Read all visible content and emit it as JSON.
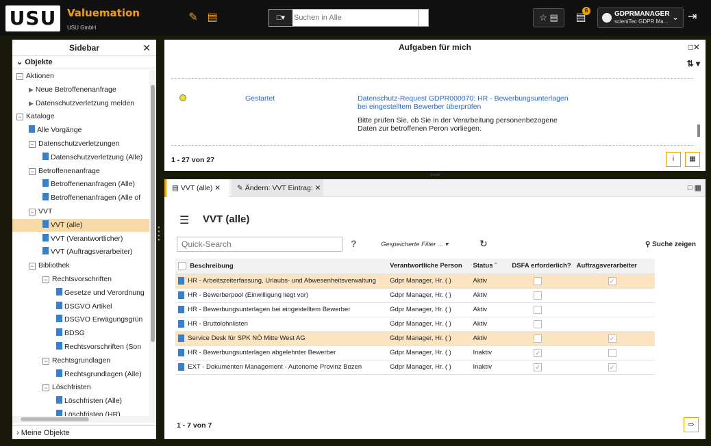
{
  "topbar": {
    "logo": "USU",
    "brand": "Valuemation",
    "brand_sub": "USU GmbH",
    "search_placeholder": "Suchen in Alle",
    "notifications_count": "6",
    "user_name": "GDPRMANAGER",
    "user_org": "scieniTec GDPR Ma..."
  },
  "sidebar": {
    "title": "Sidebar",
    "section": "Objekte",
    "footer": "Meine Objekte",
    "tree": [
      {
        "label": "Aktionen",
        "level": 0,
        "kind": "folder"
      },
      {
        "label": "Neue Betroffenenanfrage",
        "level": 1,
        "kind": "action"
      },
      {
        "label": "Datenschutzverletzung melden",
        "level": 1,
        "kind": "action"
      },
      {
        "label": "Kataloge",
        "level": 0,
        "kind": "folder"
      },
      {
        "label": "Alle Vorgänge",
        "level": 1,
        "kind": "doc"
      },
      {
        "label": "Datenschutzverletzungen",
        "level": 1,
        "kind": "folder"
      },
      {
        "label": "Datenschutzverletzung (Alle)",
        "level": 2,
        "kind": "doc"
      },
      {
        "label": "Betroffenenanfrage",
        "level": 1,
        "kind": "folder"
      },
      {
        "label": "Betroffenenanfragen (Alle)",
        "level": 2,
        "kind": "doc"
      },
      {
        "label": "Betroffenenanfragen (Alle of",
        "level": 2,
        "kind": "doc"
      },
      {
        "label": "VVT",
        "level": 1,
        "kind": "folder"
      },
      {
        "label": "VVT (alle)",
        "level": 2,
        "kind": "doc",
        "selected": true
      },
      {
        "label": "VVT (Verantwortlicher)",
        "level": 2,
        "kind": "doc"
      },
      {
        "label": "VVT (Auftragsverarbeiter)",
        "level": 2,
        "kind": "doc"
      },
      {
        "label": "Bibliothek",
        "level": 1,
        "kind": "folder"
      },
      {
        "label": "Rechtsvorschriften",
        "level": 2,
        "kind": "folder"
      },
      {
        "label": "Gesetze und Verordnung",
        "level": 3,
        "kind": "doc"
      },
      {
        "label": "DSGVO Artikel",
        "level": 3,
        "kind": "doc"
      },
      {
        "label": "DSGVO Erwägungsgrün",
        "level": 3,
        "kind": "doc"
      },
      {
        "label": "BDSG",
        "level": 3,
        "kind": "doc"
      },
      {
        "label": "Rechtsvorschriften (Son",
        "level": 3,
        "kind": "doc"
      },
      {
        "label": "Rechtsgrundlagen",
        "level": 2,
        "kind": "folder"
      },
      {
        "label": "Rechtsgrundlagen (Alle)",
        "level": 3,
        "kind": "doc"
      },
      {
        "label": "Löschfristen",
        "level": 2,
        "kind": "folder"
      },
      {
        "label": "Löschfristen (Alle)",
        "level": 3,
        "kind": "doc"
      },
      {
        "label": "Löschfristen (HR)",
        "level": 3,
        "kind": "doc"
      }
    ]
  },
  "tasks": {
    "title": "Aufgaben für mich",
    "status": "Gestartet",
    "link": "Datenschutz-Request GDPR000070: HR - Bewerbungsunterlagen bei eingestelltem Bewerber überprüfen",
    "description": "Bitte prüfen Sie, ob Sie in der Verarbeitung personenbezogene Daten zur betroffenen Peron vorliegen.",
    "count": "1 - 27 von 27"
  },
  "tabs": [
    {
      "label": "VVT (alle)"
    },
    {
      "label": "Ändern: VVT Eintrag:"
    }
  ],
  "list": {
    "title": "VVT (alle)",
    "quick_search_placeholder": "Quick-Search",
    "saved_filter": "Gespeicherte Filter ...",
    "search_show": "Suche zeigen",
    "columns": [
      "Beschreibung",
      "Verantwortliche Person",
      "Status",
      "DSFA erforderlich?",
      "Auftragsverarbeiter"
    ],
    "rows": [
      {
        "desc": "HR - Arbeitszeiterfassung, Urlaubs- und Abwesenheitsverwaltung",
        "person": "Gdpr Manager, Hr. (  )",
        "status": "Aktiv",
        "dsfa": false,
        "av": true,
        "hl": true
      },
      {
        "desc": "HR - Bewerberpool (Einwilligung liegt vor)",
        "person": "Gdpr Manager, Hr. (  )",
        "status": "Aktiv",
        "dsfa": false,
        "av": null,
        "hl": false
      },
      {
        "desc": "HR - Bewerbungsunterlagen bei eingestelltem Bewerber",
        "person": "Gdpr Manager, Hr. (  )",
        "status": "Aktiv",
        "dsfa": false,
        "av": null,
        "hl": false
      },
      {
        "desc": "HR - Bruttolohnlisten",
        "person": "Gdpr Manager, Hr. (  )",
        "status": "Aktiv",
        "dsfa": false,
        "av": null,
        "hl": false
      },
      {
        "desc": "Service Desk für SPK NÖ Mitte West AG",
        "person": "Gdpr Manager, Hr. (  )",
        "status": "Aktiv",
        "dsfa": false,
        "av": true,
        "hl": true
      },
      {
        "desc": "HR - Bewerbungsunterlagen abgelehnter  Bewerber",
        "person": "Gdpr Manager, Hr. (  )",
        "status": "Inaktiv",
        "dsfa": true,
        "av": false,
        "hl": false
      },
      {
        "desc": "EXT - Dokumenten Management - Autonome Provinz Bozen",
        "person": "Gdpr Manager, Hr. (  )",
        "status": "Inaktiv",
        "dsfa": true,
        "av": true,
        "hl": false
      }
    ],
    "count": "1 - 7 von 7"
  }
}
